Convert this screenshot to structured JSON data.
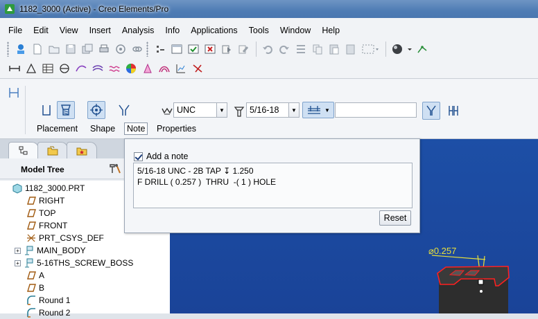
{
  "window": {
    "title": "1182_3000 (Active) - Creo Elements/Pro"
  },
  "menu": [
    "File",
    "Edit",
    "View",
    "Insert",
    "Analysis",
    "Info",
    "Applications",
    "Tools",
    "Window",
    "Help"
  ],
  "dashboard": {
    "thread_standard": "UNC",
    "screw_size": "5/16-18",
    "depth_value": "",
    "tabs": [
      "Placement",
      "Shape",
      "Note",
      "Properties"
    ],
    "active_tab": "Note"
  },
  "note_panel": {
    "checkbox_label": "Add a note",
    "checked": true,
    "note_line1": "5/16-18 UNC - 2B TAP",
    "note_depth_symbol": "↧",
    "note_depth": "1.250",
    "note_line2": "F DRILL ( 0.257 )  THRU  -( 1 ) HOLE",
    "reset_label": "Reset"
  },
  "model_tree": {
    "title": "Model Tree",
    "items": [
      {
        "label": "1182_3000.PRT",
        "icon": "part-icon",
        "expandable": false
      },
      {
        "label": "RIGHT",
        "icon": "datum-plane-icon",
        "expandable": false
      },
      {
        "label": "TOP",
        "icon": "datum-plane-icon",
        "expandable": false
      },
      {
        "label": "FRONT",
        "icon": "datum-plane-icon",
        "expandable": false
      },
      {
        "label": "PRT_CSYS_DEF",
        "icon": "csys-icon",
        "expandable": false
      },
      {
        "label": "MAIN_BODY",
        "icon": "extrude-icon",
        "expandable": true
      },
      {
        "label": "5-16THS_SCREW_BOSS",
        "icon": "extrude-icon",
        "expandable": true
      },
      {
        "label": "A",
        "icon": "datum-plane-icon",
        "expandable": false
      },
      {
        "label": "B",
        "icon": "datum-plane-icon",
        "expandable": false
      },
      {
        "label": "Round 1",
        "icon": "round-icon",
        "expandable": false
      },
      {
        "label": "Round 2",
        "icon": "round-icon",
        "expandable": false
      }
    ]
  },
  "graphics": {
    "dimension_label": "⌀0.257"
  },
  "colors": {
    "graphics_bg": "#1b4aa0",
    "dimension": "#e8e03a",
    "highlight": "#ff2020"
  }
}
